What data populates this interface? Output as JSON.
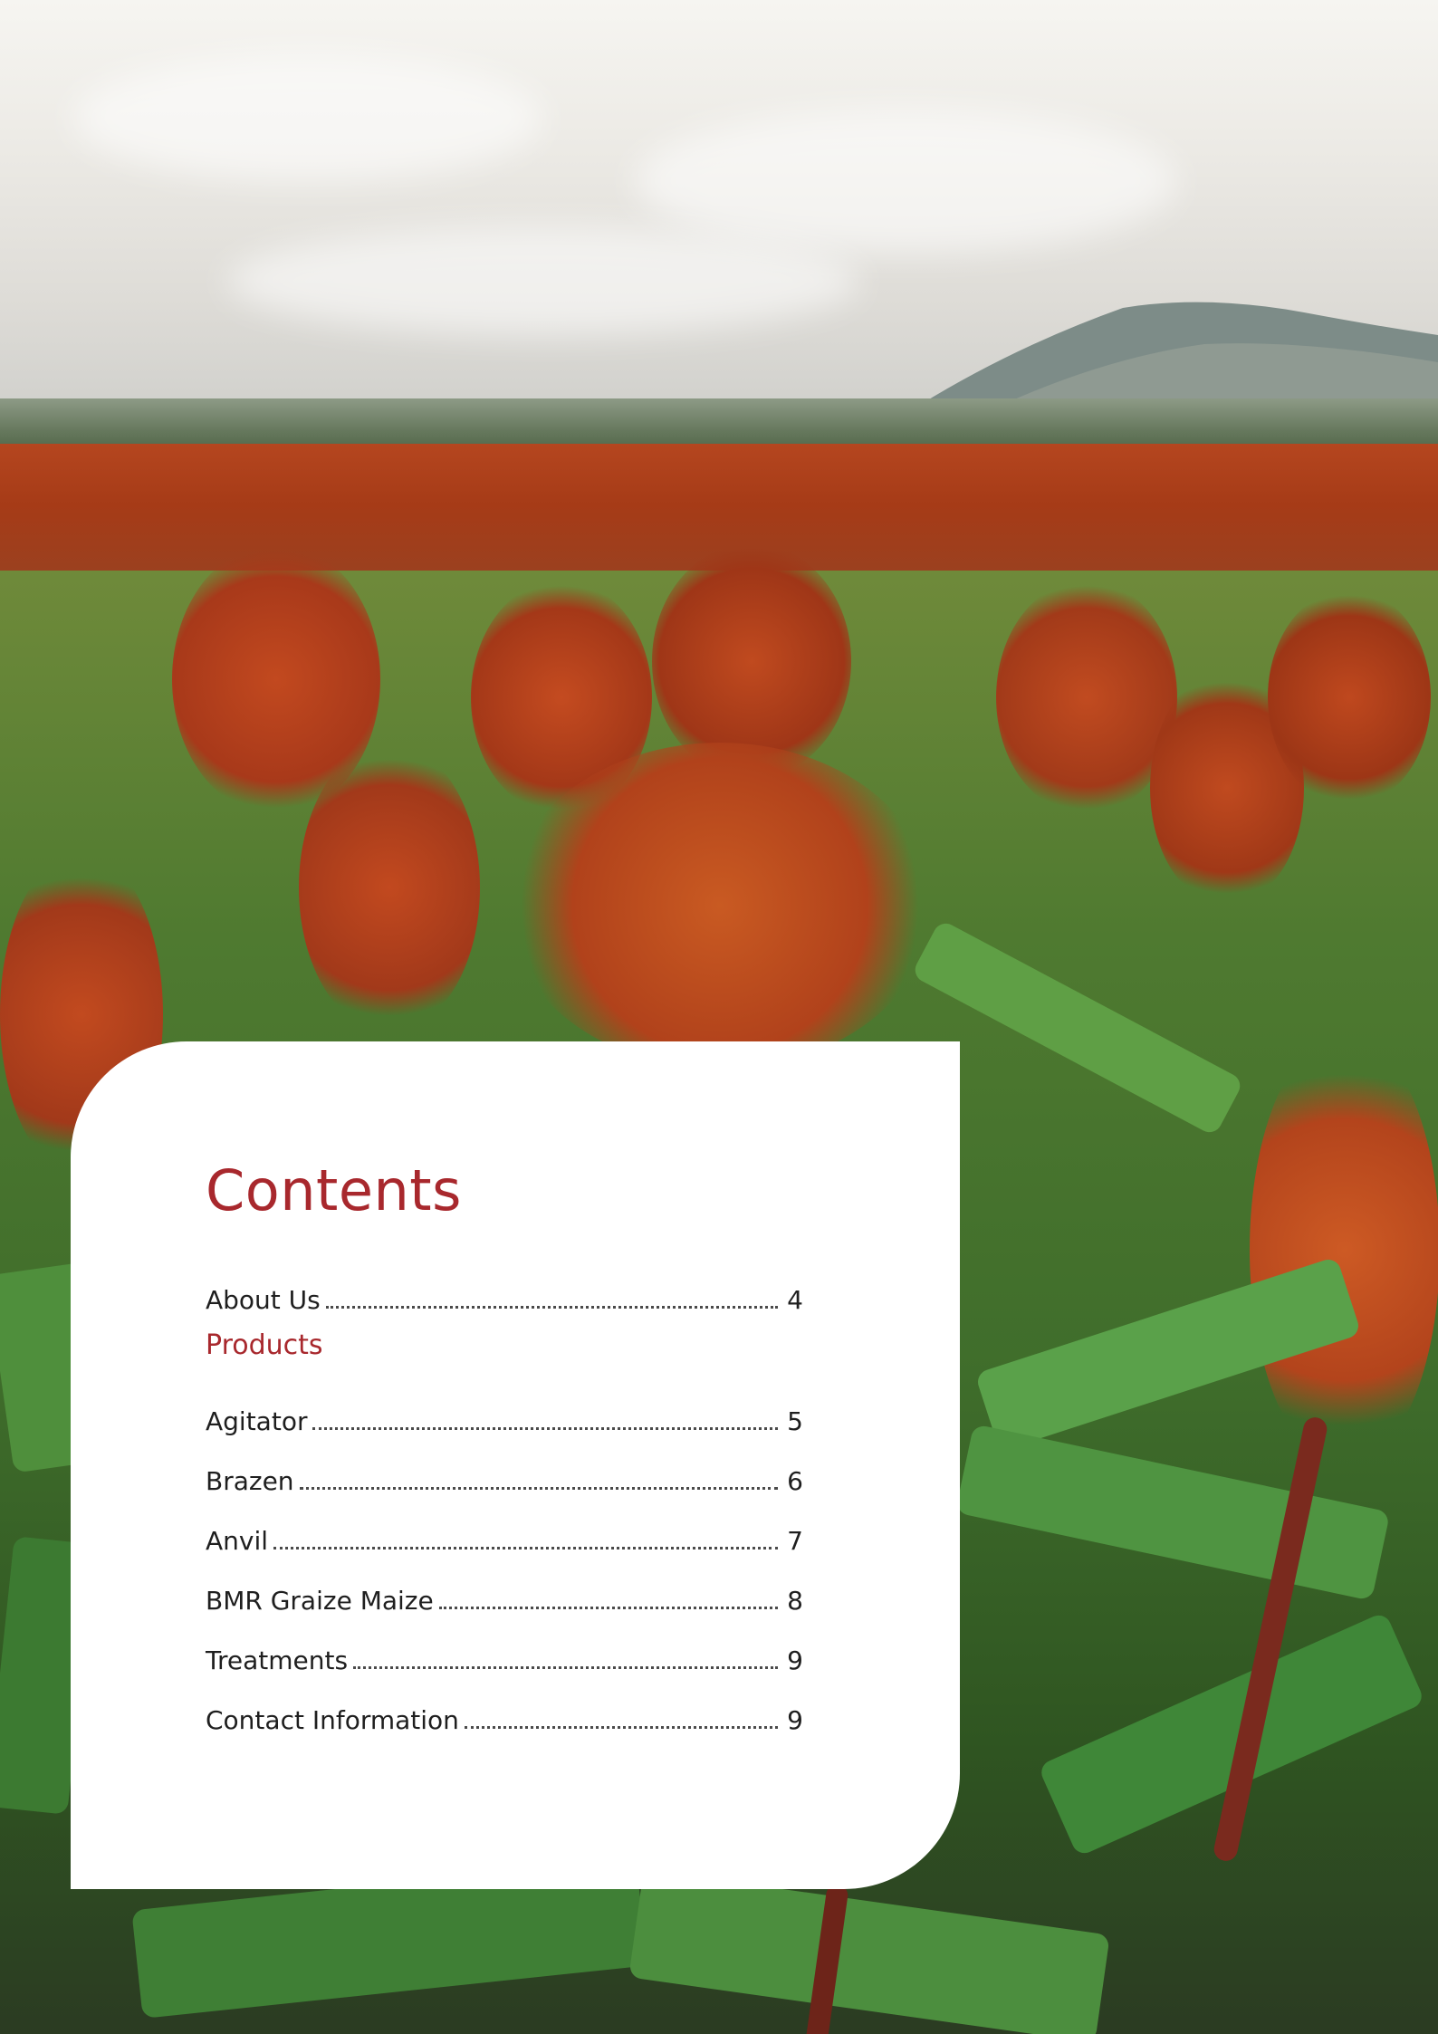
{
  "contents": {
    "title": "Contents",
    "about": {
      "label": "About Us",
      "page": "4"
    },
    "section_heading": "Products",
    "items": [
      {
        "label": "Agitator",
        "page": "5"
      },
      {
        "label": "Brazen",
        "page": "6"
      },
      {
        "label": "Anvil",
        "page": "7"
      },
      {
        "label": "BMR Graize Maize",
        "page": "8"
      },
      {
        "label": "Treatments",
        "page": "9"
      },
      {
        "label": "Contact Information",
        "page": "9"
      }
    ]
  },
  "colors": {
    "accent": "#a8282d",
    "text": "#1f1f1f",
    "card": "#ffffff"
  }
}
